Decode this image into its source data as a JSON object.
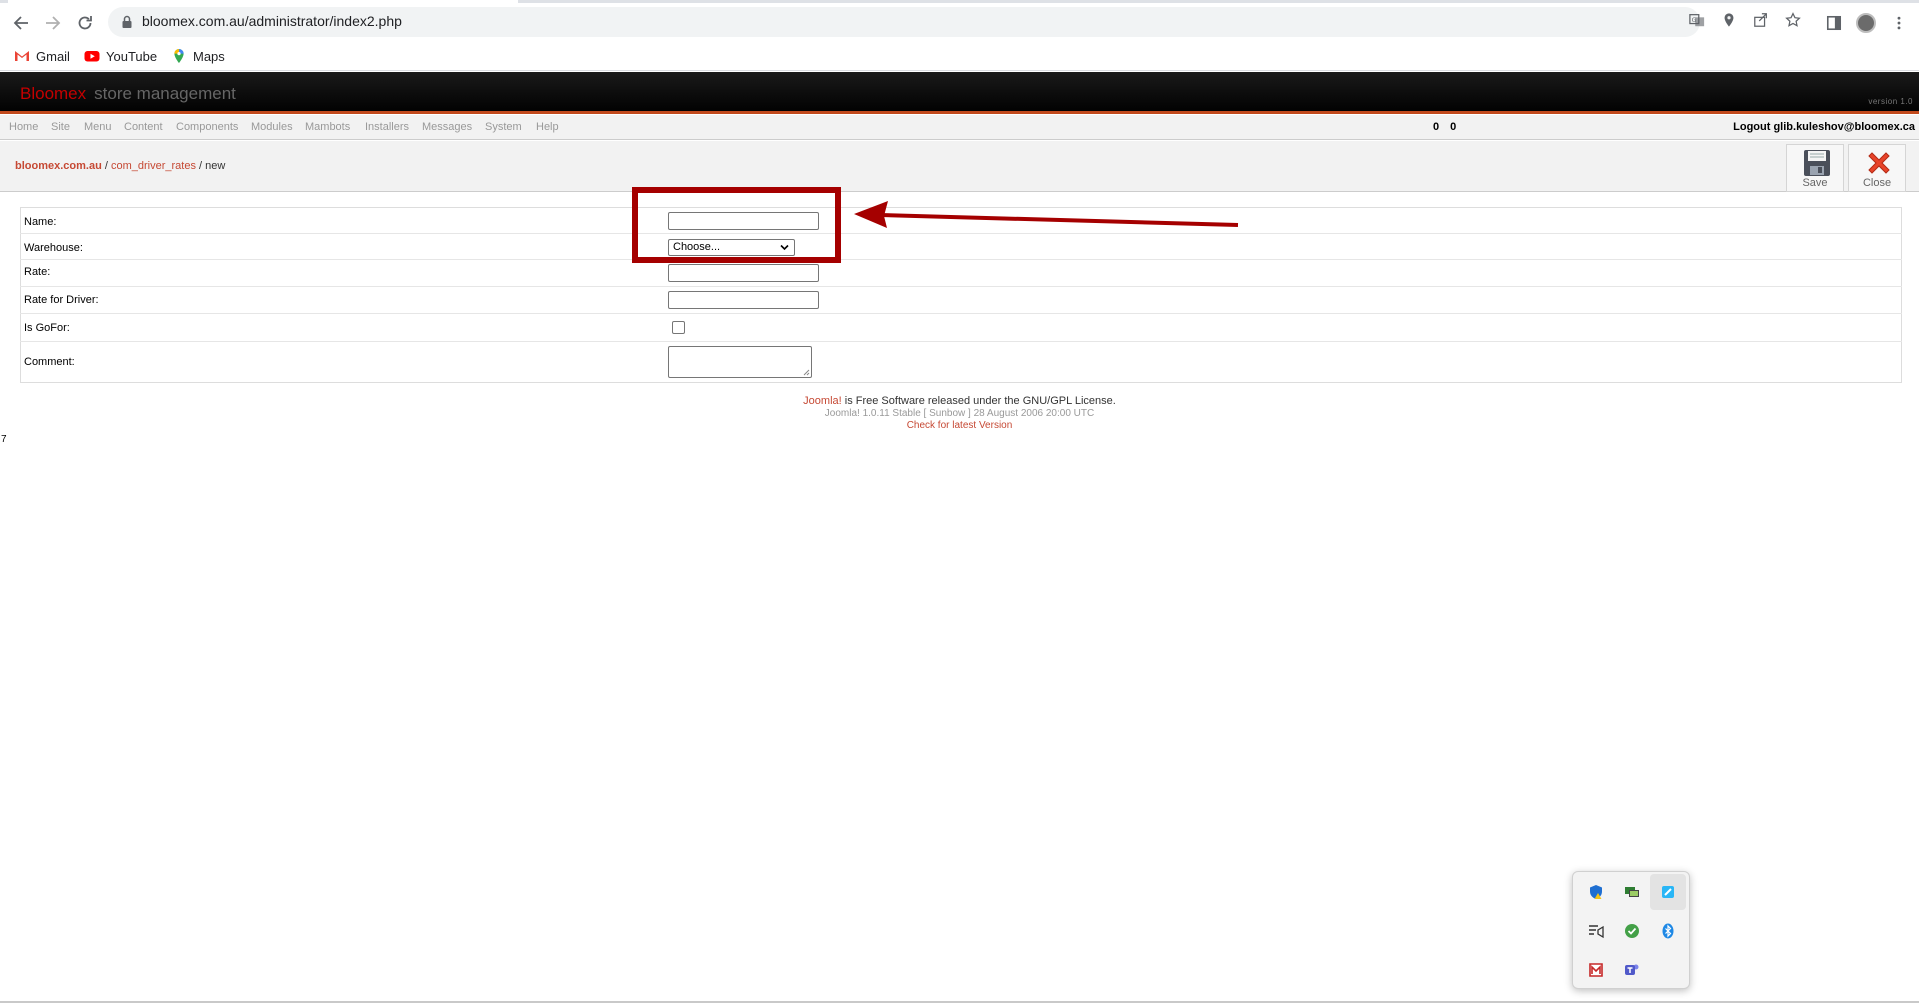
{
  "browser": {
    "url": "bloomex.com.au/administrator/index2.php",
    "bookmarks": [
      {
        "label": "Gmail",
        "icon": "gmail-icon"
      },
      {
        "label": "YouTube",
        "icon": "youtube-icon"
      },
      {
        "label": "Maps",
        "icon": "maps-icon"
      }
    ]
  },
  "header": {
    "brand_main": "Bloomex",
    "brand_sub": "store management",
    "version": "version 1.0"
  },
  "menu": {
    "items": [
      "Home",
      "Site",
      "Menu",
      "Content",
      "Components",
      "Modules",
      "Mambots",
      "Installers",
      "Messages",
      "System",
      "Help"
    ],
    "counts": "0 0",
    "logout": "Logout glib.kuleshov@bloomex.ca"
  },
  "pathway": {
    "site": "bloomex.com.au",
    "separator": " / ",
    "component": "com_driver_rates",
    "page": "new"
  },
  "toolbar": {
    "save_label": "Save",
    "close_label": "Close"
  },
  "form": {
    "name_label": "Name:",
    "warehouse_label": "Warehouse:",
    "warehouse_value": "Choose...",
    "rate_label": "Rate:",
    "rate_driver_label": "Rate for Driver:",
    "gofor_label": "Is GoFor:",
    "comment_label": "Comment:"
  },
  "footer": {
    "joomla_link": "Joomla!",
    "license_text": " is Free Software released under the GNU/GPL License.",
    "version_text": "Joomla! 1.0.11 Stable [ Sunbow ] 28 August 2006 20:00 UTC",
    "check_link": "Check for latest Version"
  },
  "stray_text": "7",
  "colors": {
    "accent_red": "#c64934",
    "brand_red": "#c40000",
    "annotation_red": "#a50000",
    "header_black": "#000000"
  }
}
